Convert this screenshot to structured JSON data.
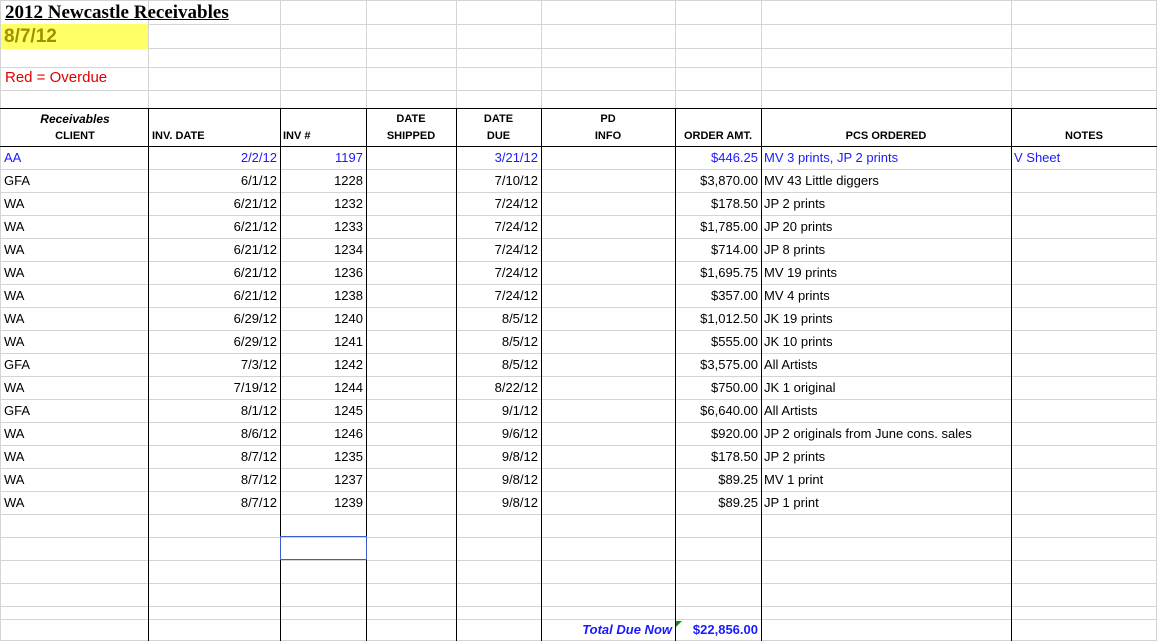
{
  "sheet": {
    "title": "2012 Newcastle Receivables",
    "date": "8/7/12",
    "legend": "Red = Overdue"
  },
  "headers": {
    "receivables": "Receivables",
    "client": "CLIENT",
    "inv_date": "INV. DATE",
    "inv_no": "INV #",
    "date_shipped_1": "DATE",
    "date_shipped_2": "SHIPPED",
    "date_due_1": "DATE",
    "date_due_2": "DUE",
    "pd_info_1": "PD",
    "pd_info_2": "INFO",
    "order_amt": "ORDER AMT.",
    "pcs_ordered": "PCS ORDERED",
    "notes": "NOTES"
  },
  "rows": [
    {
      "client": "AA",
      "inv_date": "2/2/12",
      "inv_no": "1197",
      "shipped": "",
      "due": "3/21/12",
      "pd": "",
      "amt": "$446.25",
      "pcs": "MV 3 prints, JP 2 prints",
      "notes": "V Sheet",
      "blue": true
    },
    {
      "client": "GFA",
      "inv_date": "6/1/12",
      "inv_no": "1228",
      "shipped": "",
      "due": "7/10/12",
      "pd": "",
      "amt": "$3,870.00",
      "pcs": "MV 43 Little diggers",
      "notes": ""
    },
    {
      "client": "WA",
      "inv_date": "6/21/12",
      "inv_no": "1232",
      "shipped": "",
      "due": "7/24/12",
      "pd": "",
      "amt": "$178.50",
      "pcs": "JP 2 prints",
      "notes": ""
    },
    {
      "client": "WA",
      "inv_date": "6/21/12",
      "inv_no": "1233",
      "shipped": "",
      "due": "7/24/12",
      "pd": "",
      "amt": "$1,785.00",
      "pcs": "JP 20 prints",
      "notes": ""
    },
    {
      "client": "WA",
      "inv_date": "6/21/12",
      "inv_no": "1234",
      "shipped": "",
      "due": "7/24/12",
      "pd": "",
      "amt": "$714.00",
      "pcs": "JP 8 prints",
      "notes": ""
    },
    {
      "client": "WA",
      "inv_date": "6/21/12",
      "inv_no": "1236",
      "shipped": "",
      "due": "7/24/12",
      "pd": "",
      "amt": "$1,695.75",
      "pcs": "MV 19 prints",
      "notes": ""
    },
    {
      "client": "WA",
      "inv_date": "6/21/12",
      "inv_no": "1238",
      "shipped": "",
      "due": "7/24/12",
      "pd": "",
      "amt": "$357.00",
      "pcs": "MV 4 prints",
      "notes": ""
    },
    {
      "client": "WA",
      "inv_date": "6/29/12",
      "inv_no": "1240",
      "shipped": "",
      "due": "8/5/12",
      "pd": "",
      "amt": "$1,012.50",
      "pcs": "JK 19 prints",
      "notes": ""
    },
    {
      "client": "WA",
      "inv_date": "6/29/12",
      "inv_no": "1241",
      "shipped": "",
      "due": "8/5/12",
      "pd": "",
      "amt": "$555.00",
      "pcs": "JK 10 prints",
      "notes": ""
    },
    {
      "client": "GFA",
      "inv_date": "7/3/12",
      "inv_no": "1242",
      "shipped": "",
      "due": "8/5/12",
      "pd": "",
      "amt": "$3,575.00",
      "pcs": "All Artists",
      "notes": ""
    },
    {
      "client": "WA",
      "inv_date": "7/19/12",
      "inv_no": "1244",
      "shipped": "",
      "due": "8/22/12",
      "pd": "",
      "amt": "$750.00",
      "pcs": "JK 1 original",
      "notes": ""
    },
    {
      "client": "GFA",
      "inv_date": "8/1/12",
      "inv_no": "1245",
      "shipped": "",
      "due": "9/1/12",
      "pd": "",
      "amt": "$6,640.00",
      "pcs": "All Artists",
      "notes": ""
    },
    {
      "client": "WA",
      "inv_date": "8/6/12",
      "inv_no": "1246",
      "shipped": "",
      "due": "9/6/12",
      "pd": "",
      "amt": "$920.00",
      "pcs": "JP 2 originals from June cons. sales",
      "notes": ""
    },
    {
      "client": "WA",
      "inv_date": "8/7/12",
      "inv_no": "1235",
      "shipped": "",
      "due": "9/8/12",
      "pd": "",
      "amt": "$178.50",
      "pcs": "JP 2 prints",
      "notes": ""
    },
    {
      "client": "WA",
      "inv_date": "8/7/12",
      "inv_no": "1237",
      "shipped": "",
      "due": "9/8/12",
      "pd": "",
      "amt": "$89.25",
      "pcs": "MV 1 print",
      "notes": ""
    },
    {
      "client": "WA",
      "inv_date": "8/7/12",
      "inv_no": "1239",
      "shipped": "",
      "due": "9/8/12",
      "pd": "",
      "amt": "$89.25",
      "pcs": "JP 1 print",
      "notes": ""
    }
  ],
  "total": {
    "label": "Total Due Now",
    "amount": "$22,856.00"
  },
  "colors": {
    "gridline": "#d4d4d4",
    "blue_text": "#1a1aff",
    "overdue_red": "#e00000",
    "date_highlight": "#ffff66"
  }
}
